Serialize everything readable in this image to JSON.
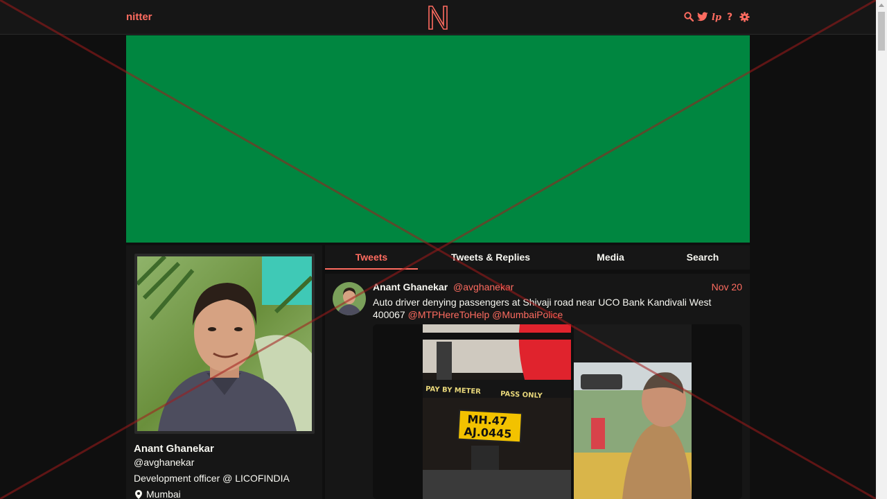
{
  "nav": {
    "site_name": "nitter",
    "icons": [
      "search-icon",
      "twitter-bird-icon",
      "liberapay-icon",
      "help-icon",
      "gear-icon"
    ],
    "accent_color": "#ff6c60"
  },
  "banner": {
    "color": "#008640"
  },
  "profile": {
    "fullname": "Anant Ghanekar",
    "username": "@avghanekar",
    "bio": "Development officer @ LICOFINDIA",
    "location": "Mumbai"
  },
  "tabs": [
    {
      "label": "Tweets",
      "active": true
    },
    {
      "label": "Tweets & Replies",
      "active": false
    },
    {
      "label": "Media",
      "active": false
    },
    {
      "label": "Search",
      "active": false
    }
  ],
  "tweet": {
    "fullname": "Anant Ghanekar",
    "username": "@avghanekar",
    "date": "Nov 20",
    "text_line1": "Auto driver denying passengers at Shivaji road near UCO Bank Kandivali West",
    "text_line2_prefix": "400067",
    "mention1": "@MTPHereToHelp",
    "mention2": "@MumbaiPolice",
    "image1": {
      "sign_top": "PAY BY METER",
      "sign_right": "PASS ONLY",
      "plate_line1": "MH.47",
      "plate_line2": "AJ.0445"
    }
  }
}
